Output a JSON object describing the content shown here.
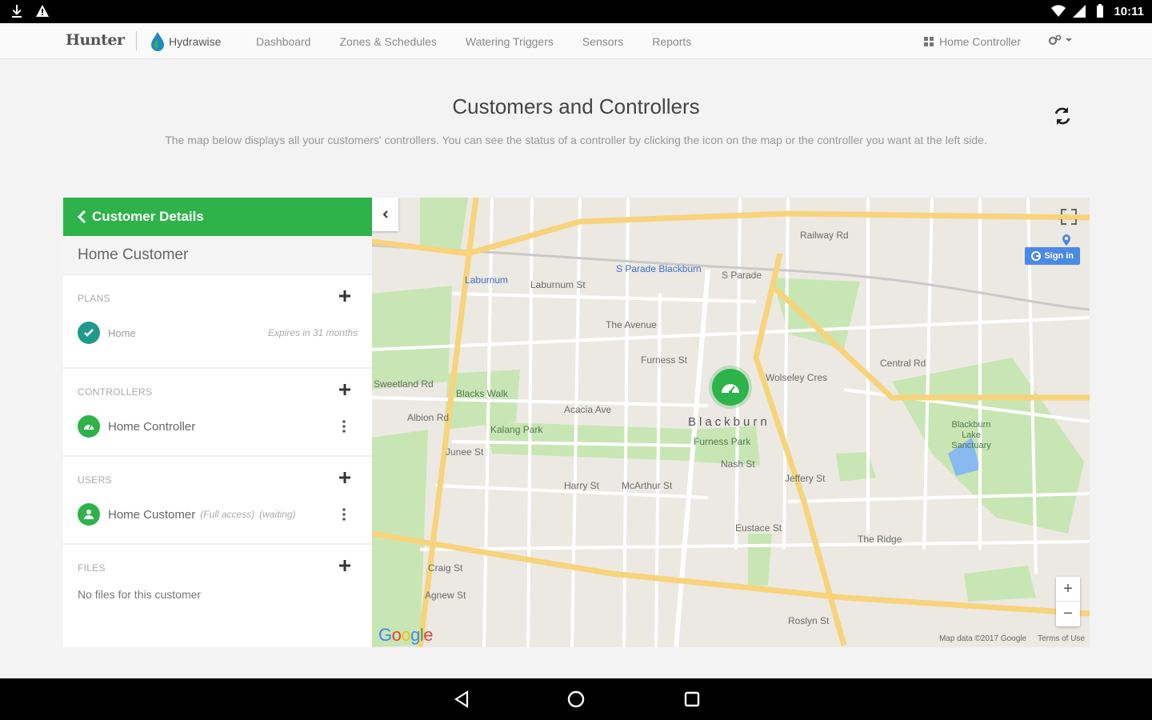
{
  "status_bar": {
    "time": "10:11"
  },
  "nav": {
    "brand": "Hunter",
    "hydra_brand": "Hydrawise",
    "links": [
      "Dashboard",
      "Zones & Schedules",
      "Watering Triggers",
      "Sensors",
      "Reports"
    ],
    "controller_label": "Home Controller"
  },
  "page": {
    "title": "Customers and Controllers",
    "description": "The map below displays all your customers' controllers. You can see the status of a controller by clicking the icon on the map or the controller you want at the left side."
  },
  "panel": {
    "header": "Customer Details",
    "customer_name": "Home Customer",
    "plans": {
      "title": "PLANS",
      "item": "Home",
      "expires": "Expires in 31 months"
    },
    "controllers": {
      "title": "CONTROLLERS",
      "item": "Home Controller"
    },
    "users": {
      "title": "USERS",
      "item": "Home Customer",
      "access": "(Full access)",
      "status": "(waiting)"
    },
    "files": {
      "title": "FILES",
      "empty": "No files for this customer"
    }
  },
  "map": {
    "sign_in": "Sign in",
    "google": "Google",
    "attribution": "Map data ©2017 Google",
    "terms": "Terms of Use",
    "zoom_in": "+",
    "zoom_out": "−",
    "labels": {
      "blackburn": "Blackburn",
      "laburnum_st": "Laburnum St",
      "laburnum_station": "Laburnum",
      "blackburn_station": "S Parade Blackburn",
      "the_avenue": "The Avenue",
      "furness": "Furness St",
      "wolseley": "Wolseley Cres",
      "central_rd": "Central Rd",
      "blacks_walk": "Blacks Walk",
      "acacia": "Acacia Ave",
      "kalang": "Kalang Park",
      "furness_park": "Furness Park",
      "nash": "Nash St",
      "jeffery": "Jeffery St",
      "lake_sanctuary": "Blackburn Lake Sanctuary",
      "harry": "Harry St",
      "mcarthur": "McArthur St",
      "eustace": "Eustace St",
      "craig": "Craig St",
      "agnew": "Agnew St",
      "junee": "Junee St",
      "railway": "Railway Rd",
      "the_ridge": "The Ridge",
      "roslyn": "Roslyn St",
      "sweetland": "Sweetland Rd",
      "albion": "Albion Rd",
      "s_parade": "S Parade"
    },
    "colors": {
      "park": "#c8e6b4",
      "road_major": "#f7d37a",
      "road_minor": "#ffffff",
      "water": "#8ab8f0"
    }
  },
  "colors": {
    "accent": "#2eb24a"
  }
}
